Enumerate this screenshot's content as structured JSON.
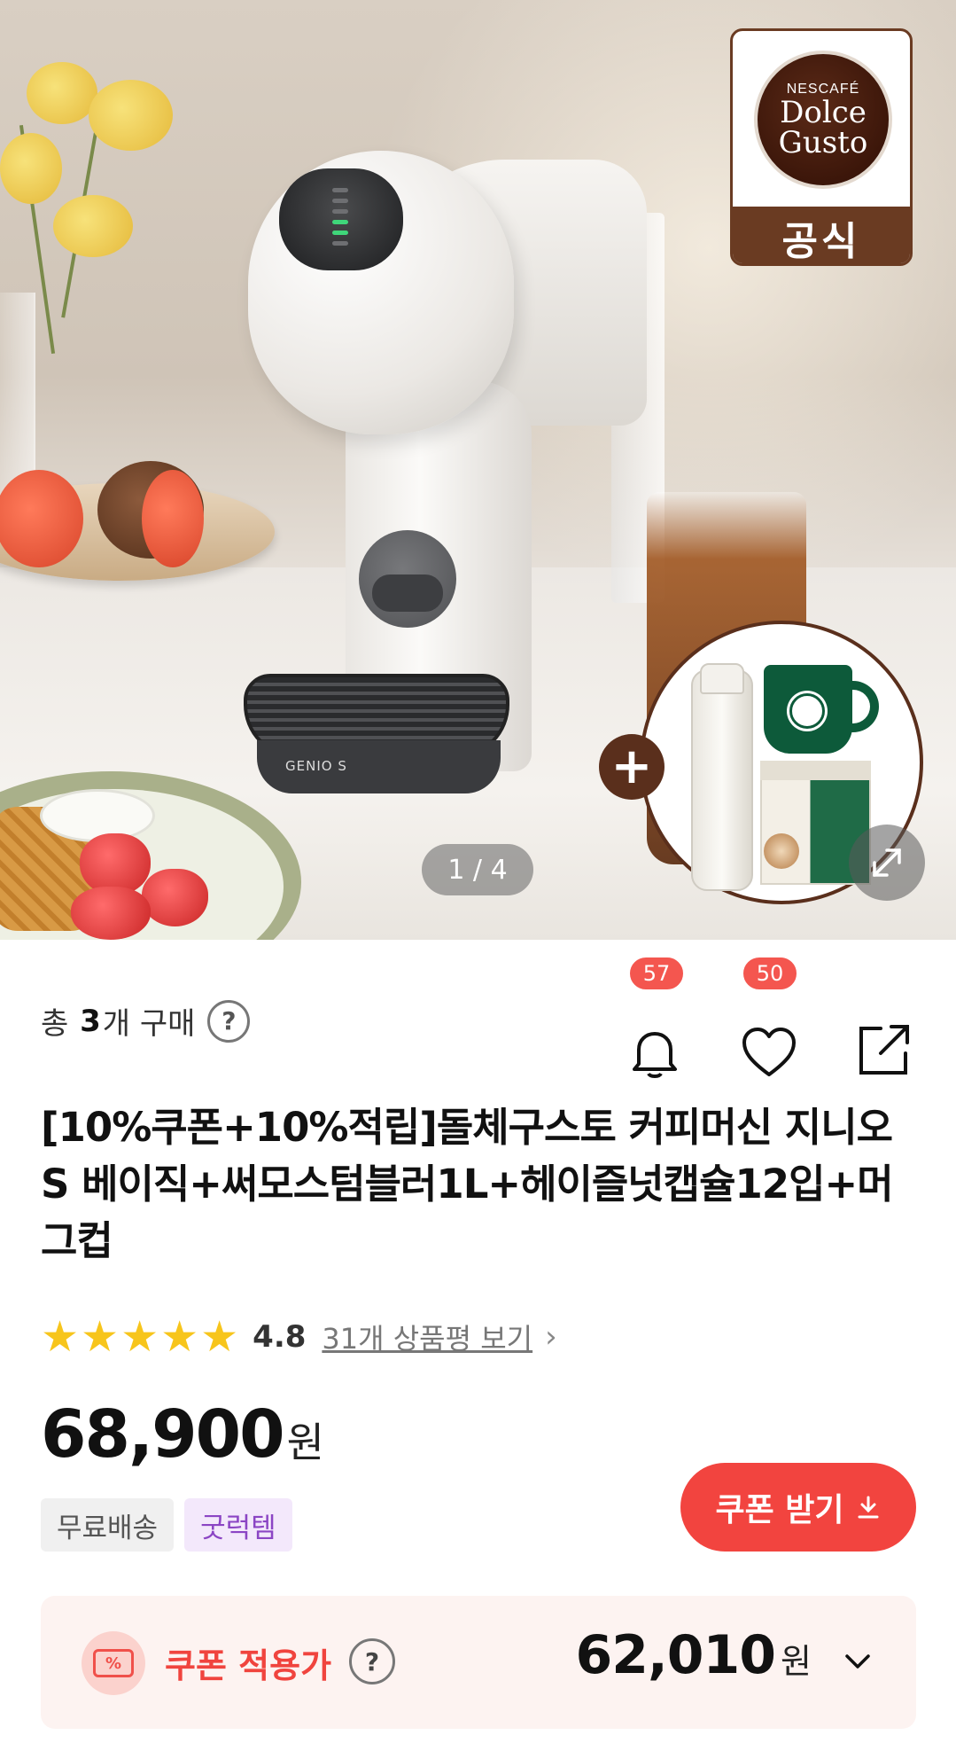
{
  "hero": {
    "pager": "1 / 4",
    "badge_brand_line1": "NESCAFÉ",
    "badge_brand_line2": "Dolce",
    "badge_brand_line3": "Gusto",
    "badge_label": "공식",
    "plus_symbol": "+",
    "machine_model": "GENIO S"
  },
  "purchase": {
    "prefix": "총",
    "count": "3",
    "suffix": "개 구매",
    "help": "?"
  },
  "actions": {
    "alarm_count": "57",
    "like_count": "50"
  },
  "product": {
    "title": "[10%쿠폰+10%적립]돌체구스토 커피머신 지니오S 베이직+써모스텀블러1L+헤이즐넛캡슐12입+머그컵",
    "rating": 4.8,
    "rating_text": "4.8",
    "stars": 5,
    "reviews_link": "31개 상품평 보기",
    "price": "68,900",
    "currency": "원",
    "tags": [
      "무료배송",
      "굿럭템"
    ]
  },
  "coupon_button": {
    "label": "쿠폰 받기"
  },
  "coupon_price": {
    "icon_text": "%",
    "label": "쿠폰 적용가",
    "help": "?",
    "price": "62,010",
    "currency": "원"
  },
  "colors": {
    "accent": "#f2443f",
    "badge_brown": "#6a3b22",
    "star": "#f7c51c",
    "good_tag": "#8b45c4"
  }
}
